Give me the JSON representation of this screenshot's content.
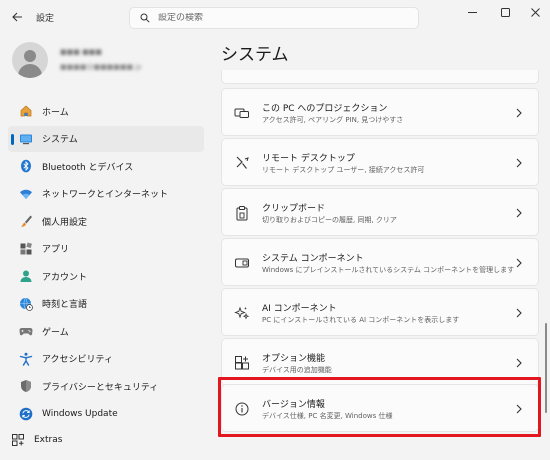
{
  "app": {
    "title": "設定",
    "back_icon": "back-arrow-icon",
    "window_controls": [
      "minimize-icon",
      "maximize-icon",
      "close-icon"
    ]
  },
  "search": {
    "placeholder": "設定の検索",
    "value": "",
    "icon": "search-icon"
  },
  "user": {
    "name": "■■■ ■■■",
    "email": "■■■■@■■■■■■.jp",
    "avatar_icon": "person-avatar-icon"
  },
  "sidebar": {
    "items": [
      {
        "label": "ホーム",
        "icon": "home-icon",
        "active": false
      },
      {
        "label": "システム",
        "icon": "system-monitor-icon",
        "active": true
      },
      {
        "label": "Bluetooth とデバイス",
        "icon": "bluetooth-icon",
        "active": false
      },
      {
        "label": "ネットワークとインターネット",
        "icon": "wifi-icon",
        "active": false
      },
      {
        "label": "個人用設定",
        "icon": "brush-icon",
        "active": false
      },
      {
        "label": "アプリ",
        "icon": "apps-icon",
        "active": false
      },
      {
        "label": "アカウント",
        "icon": "account-icon",
        "active": false
      },
      {
        "label": "時刻と言語",
        "icon": "globe-clock-icon",
        "active": false
      },
      {
        "label": "ゲーム",
        "icon": "gamepad-icon",
        "active": false
      },
      {
        "label": "アクセシビリティ",
        "icon": "accessibility-icon",
        "active": false
      },
      {
        "label": "プライバシーとセキュリティ",
        "icon": "shield-icon",
        "active": false
      },
      {
        "label": "Windows Update",
        "icon": "windows-update-icon",
        "active": false
      }
    ],
    "extras": {
      "label": "Extras",
      "icon": "extras-grid-icon"
    }
  },
  "main": {
    "title": "システム",
    "cards": [
      {
        "title": "この PC へのプロジェクション",
        "desc": "アクセス許可, ペアリング PIN, 見つけやすさ",
        "icon": "projection-icon"
      },
      {
        "title": "リモート デスクトップ",
        "desc": "リモート デスクトップ ユーザー, 接続アクセス許可",
        "icon": "remote-desktop-icon"
      },
      {
        "title": "クリップボード",
        "desc": "切り取りおよびコピーの履歴, 同期, クリア",
        "icon": "clipboard-icon"
      },
      {
        "title": "システム コンポーネント",
        "desc": "Windows にプレインストールされているシステム コンポーネントを管理します",
        "icon": "system-components-icon"
      },
      {
        "title": "AI コンポーネント",
        "desc": "PC にインストールされている AI コンポーネントを表示します",
        "icon": "ai-sparkle-icon"
      },
      {
        "title": "オプション機能",
        "desc": "デバイス用の追加機能",
        "icon": "optional-features-icon"
      },
      {
        "title": "バージョン情報",
        "desc": "デバイス仕様, PC 名変更, Windows 仕様",
        "icon": "info-icon"
      }
    ]
  },
  "colors": {
    "accent": "#0067c0",
    "highlight_box": "#e3161f",
    "background": "#f3f3f3",
    "card": "#fbfbfb"
  }
}
